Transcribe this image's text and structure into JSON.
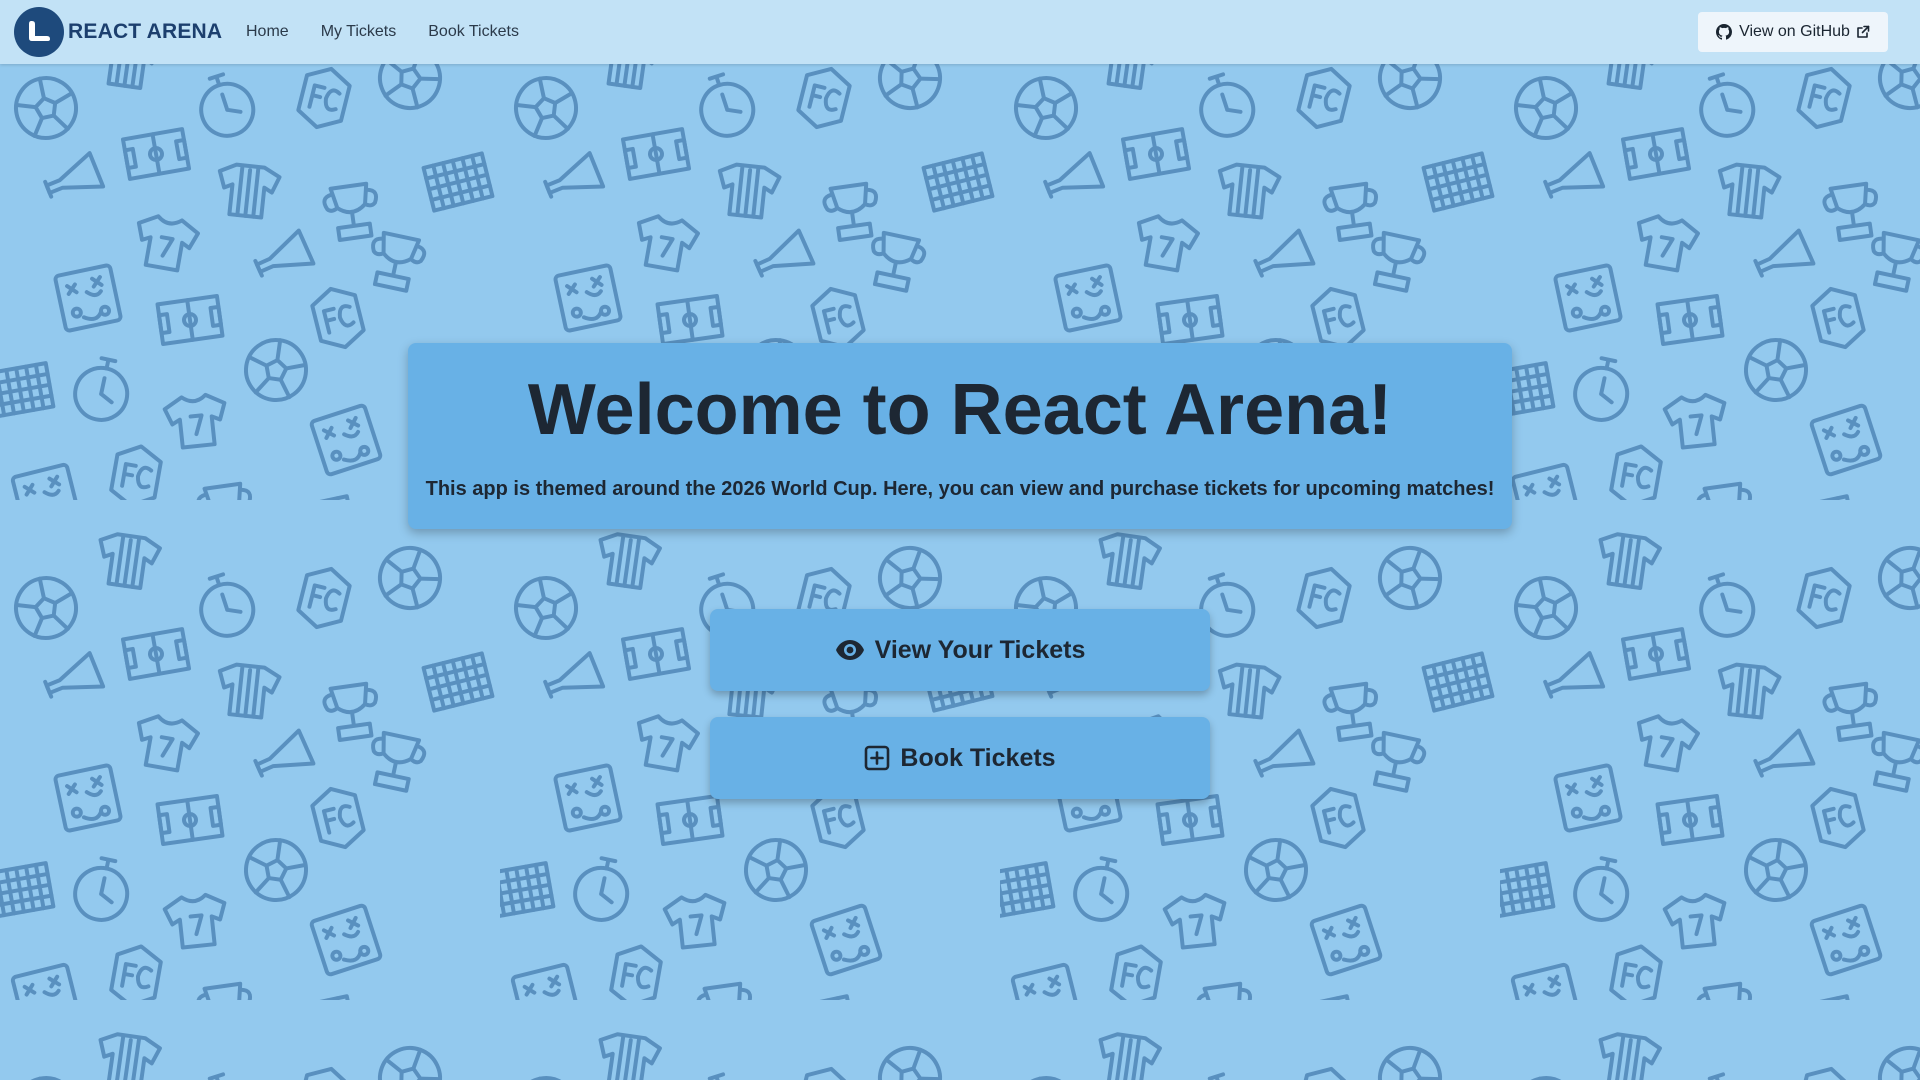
{
  "navbar": {
    "brand": "REACT ARENA",
    "links": [
      "Home",
      "My Tickets",
      "Book Tickets"
    ],
    "github_label": "View on GitHub"
  },
  "hero": {
    "title": "Welcome to React Arena!",
    "subtitle": "This app is themed around the 2026 World Cup. Here, you can view and purchase tickets for upcoming matches!"
  },
  "actions": {
    "view_label": "View Your Tickets",
    "book_label": "Book Tickets"
  },
  "icons": {
    "brand": "seat-logo-icon",
    "github": "github-icon",
    "external": "external-link-icon",
    "view": "eye-icon",
    "book": "plus-square-icon"
  },
  "colors": {
    "background": "#93c9ee",
    "navbar": "#c2e2f6",
    "card": "#68b1e6",
    "pattern": "#4f86b8",
    "brand": "#1c3f6e",
    "text": "#1d2733"
  }
}
